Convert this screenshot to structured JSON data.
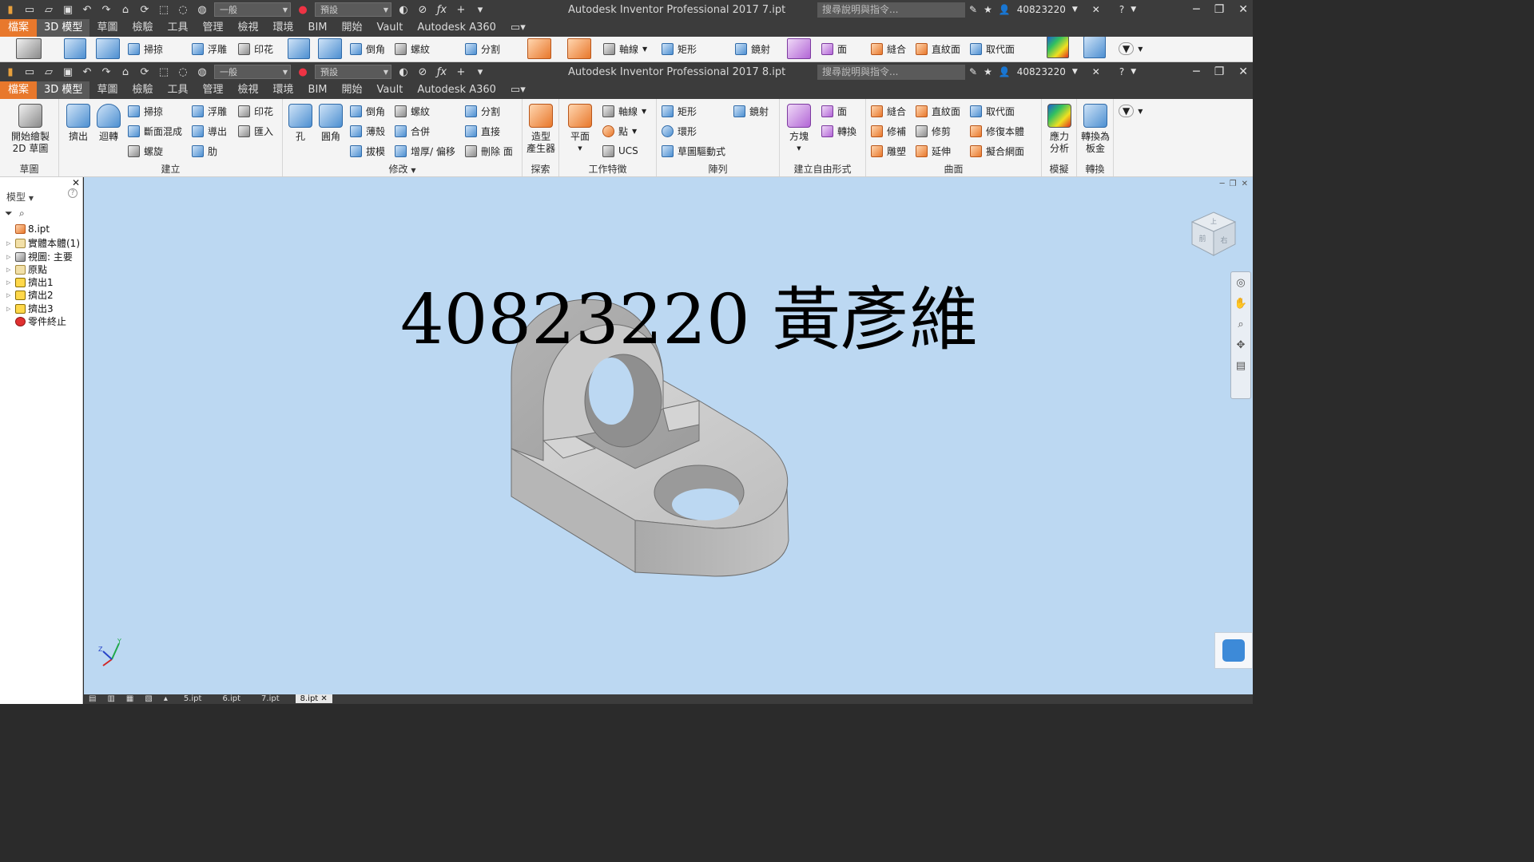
{
  "window_back": {
    "title": "Autodesk Inventor Professional 2017    7.ipt",
    "style_combo": "一般",
    "appearance_combo": "預設",
    "search_placeholder": "搜尋說明與指令...",
    "user": "40823220"
  },
  "window_front": {
    "title": "Autodesk Inventor Professional 2017    8.ipt",
    "style_combo": "一般",
    "appearance_combo": "預設",
    "search_placeholder": "搜尋說明與指令...",
    "user": "40823220"
  },
  "menu": {
    "items": [
      "檔案",
      "3D 模型",
      "草圖",
      "檢驗",
      "工具",
      "管理",
      "檢視",
      "環境",
      "BIM",
      "開始",
      "Vault",
      "Autodesk A360"
    ],
    "active": "3D 模型"
  },
  "ribbon_back": {
    "items": [
      "掃掠",
      "浮雕",
      "印花",
      "倒角",
      "螺紋",
      "分割",
      "軸線",
      "矩形",
      "鏡射",
      "面",
      "縫合",
      "直紋面",
      "取代面"
    ]
  },
  "ribbon": {
    "sketch": {
      "start_sketch": "開始繪製\n2D 草圖",
      "label": "草圖"
    },
    "create": {
      "label": "建立",
      "extrude": "擠出",
      "revolve": "迴轉",
      "sweep": "掃掠",
      "loft": "斷面混成",
      "coil": "螺旋",
      "emboss": "浮雕",
      "derive": "導出",
      "rib": "肋",
      "decal": "印花",
      "import": "匯入"
    },
    "modify": {
      "label": "修改",
      "hole": "孔",
      "fillet": "圓角",
      "chamfer": "倒角",
      "shell": "薄殼",
      "draft": "拔模",
      "thread": "螺紋",
      "combine": "合併",
      "thicken": "增厚/ 偏移",
      "split": "分割",
      "direct": "直接",
      "delete_face": "刪除 面"
    },
    "explore": {
      "label": "探索",
      "shape_generator": "造型\n產生器"
    },
    "work_features": {
      "label": "工作特徵",
      "plane": "平面",
      "axis": "軸線",
      "point": "點",
      "ucs": "UCS"
    },
    "pattern": {
      "label": "陣列",
      "rectangular": "矩形",
      "circular": "環形",
      "sketch_driven": "草圖驅動式",
      "mirror": "鏡射"
    },
    "freeform": {
      "label": "建立自由形式",
      "box": "方塊",
      "face": "面",
      "convert": "轉換"
    },
    "surface": {
      "label": "曲面",
      "stitch": "縫合",
      "patch": "修補",
      "sculpt": "雕塑",
      "ruled_surface": "直紋面",
      "trim": "修剪",
      "extend": "延伸",
      "replace_face": "取代面",
      "repair_bodies": "修復本體",
      "fit_mesh_face": "擬合網面"
    },
    "simulation": {
      "label": "模擬",
      "stress_analysis": "應力\n分析"
    },
    "convert": {
      "label": "轉換",
      "to_sheet_metal": "轉換為\n板金"
    }
  },
  "browser": {
    "title": "模型",
    "items": [
      {
        "label": "8.ipt"
      },
      {
        "label": "實體本體(1)"
      },
      {
        "label": "視圖: 主要"
      },
      {
        "label": "原點"
      },
      {
        "label": "擠出1"
      },
      {
        "label": "擠出2"
      },
      {
        "label": "擠出3"
      },
      {
        "label": "零件終止"
      }
    ]
  },
  "viewport": {
    "overlay_text": "40823220 黃彥維",
    "viewcube_labels": [
      "上",
      "右",
      "前"
    ]
  },
  "doc_tabs": [
    "5.ipt",
    "6.ipt",
    "7.ipt",
    "8.ipt"
  ],
  "active_doc": "8.ipt",
  "colors": {
    "accent": "#e8782c",
    "viewport_bg": "#bcd8f2",
    "titlebar": "#3c3c3c"
  }
}
